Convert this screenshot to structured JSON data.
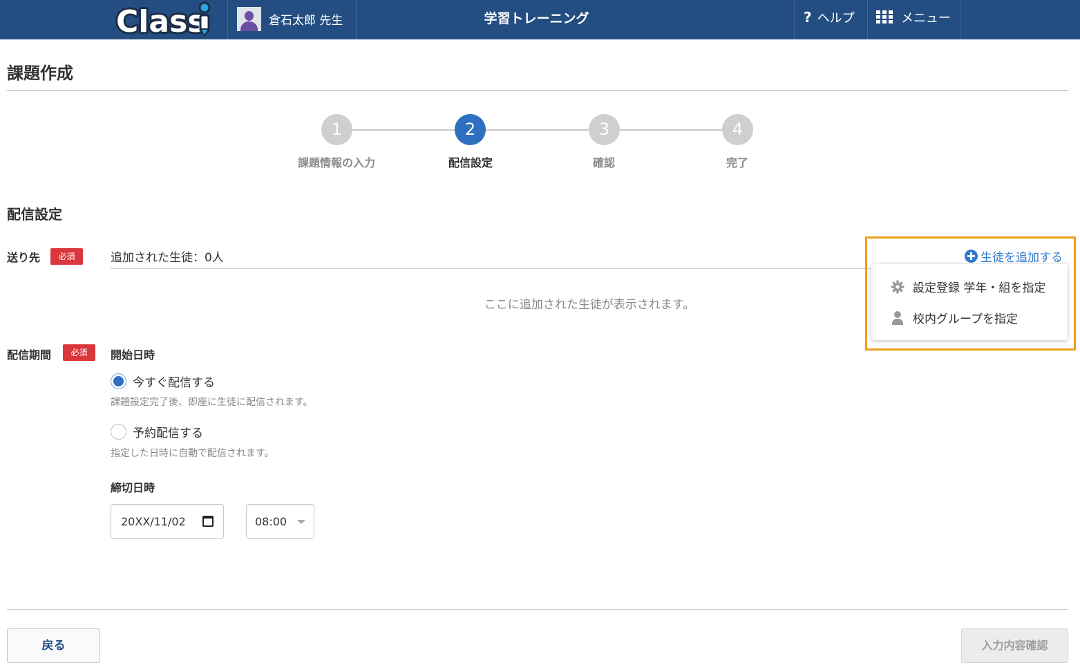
{
  "header": {
    "logo_text": "Classi",
    "user_name": "倉石太郎 先生",
    "app_title": "学習トレーニング",
    "help_label": "ヘルプ",
    "menu_label": "メニュー"
  },
  "page": {
    "title": "課題作成"
  },
  "steps": [
    {
      "number": "1",
      "label": "課題情報の入力",
      "active": false
    },
    {
      "number": "2",
      "label": "配信設定",
      "active": true
    },
    {
      "number": "3",
      "label": "確認",
      "active": false
    },
    {
      "number": "4",
      "label": "完了",
      "active": false
    }
  ],
  "delivery": {
    "section_title": "配信設定",
    "recipients": {
      "label": "送り先",
      "required_badge": "必須",
      "added_count_text": "追加された生徒：0人",
      "empty_message": "ここに追加された生徒が表示されます。",
      "add_link": "生徒を追加する",
      "dropdown_items": [
        {
          "icon": "gear-icon",
          "label": "設定登録 学年・組を指定"
        },
        {
          "icon": "person-icon",
          "label": "校内グループを指定"
        }
      ]
    },
    "period": {
      "label": "配信期間",
      "required_badge": "必須",
      "start_label": "開始日時",
      "options": [
        {
          "label": "今すぐ配信する",
          "hint": "課題設定完了後、即座に生徒に配信されます。",
          "checked": true
        },
        {
          "label": "予約配信する",
          "hint": "指定した日時に自動で配信されます。",
          "checked": false
        }
      ],
      "deadline_label": "締切日時",
      "deadline_date": "20XX/11/02",
      "deadline_time": "08:00"
    }
  },
  "footer": {
    "back_label": "戻る",
    "confirm_label": "入力内容確認"
  },
  "colors": {
    "header_bg": "#244e82",
    "accent": "#2f6fc1",
    "required": "#d9373c",
    "highlight": "#ef9e19",
    "link": "#2f7bd0"
  }
}
